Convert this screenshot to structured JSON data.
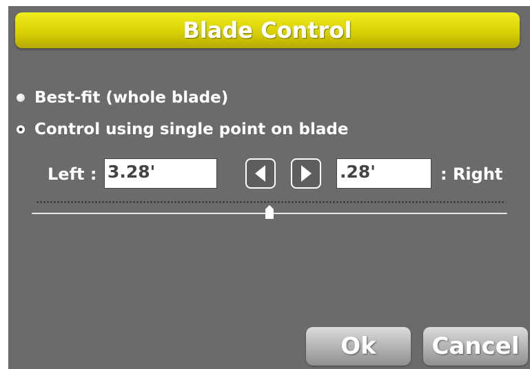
{
  "dialog": {
    "title": "Blade Control"
  },
  "options": {
    "best_fit_label": "Best-fit (whole blade)",
    "single_point_label": "Control using single point on blade",
    "selected": "single_point"
  },
  "offsets": {
    "left_label": "Left :",
    "left_value": "3.28'",
    "right_label": ": Right",
    "right_value": ".28'"
  },
  "slider": {
    "position_fraction": 0.5
  },
  "buttons": {
    "ok_label": "Ok",
    "cancel_label": "Cancel"
  },
  "icons": {
    "left_arrow": "triangle-left-icon",
    "right_arrow": "triangle-right-icon"
  },
  "colors": {
    "title_bar": "#d8d106",
    "dialog_background": "#6b6b6b",
    "text": "#ffffff"
  }
}
